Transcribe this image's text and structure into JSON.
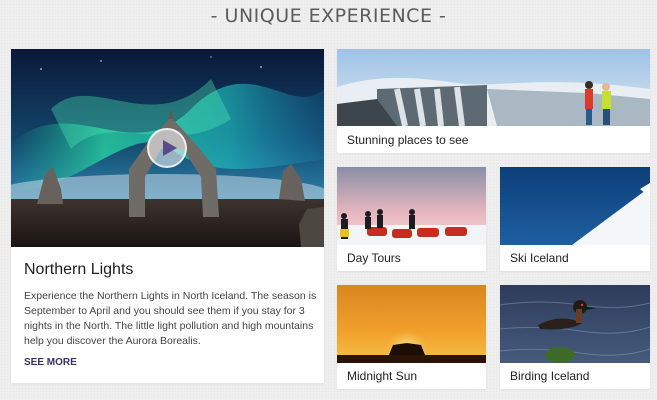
{
  "section": {
    "title": "- UNIQUE EXPERIENCE -"
  },
  "main_card": {
    "title": "Northern Lights",
    "description": "Experience the Northern Lights in North Iceland. The season is September to April and you should see them if you stay for 3 nights in the North. The little light pollution and high mountains help you discover the Aurora Borealis.",
    "see_more": "SEE MORE",
    "play_icon": "play-icon"
  },
  "cards": {
    "stunning": {
      "label": "Stunning places to see"
    },
    "day_tours": {
      "label": "Day Tours"
    },
    "ski": {
      "label": "Ski Iceland"
    },
    "midnight": {
      "label": "Midnight Sun"
    },
    "birding": {
      "label": "Birding Iceland"
    }
  },
  "colors": {
    "background": "#efefef",
    "card": "#ffffff",
    "see_more": "#3a2f6b",
    "title": "#5c5c5c"
  }
}
